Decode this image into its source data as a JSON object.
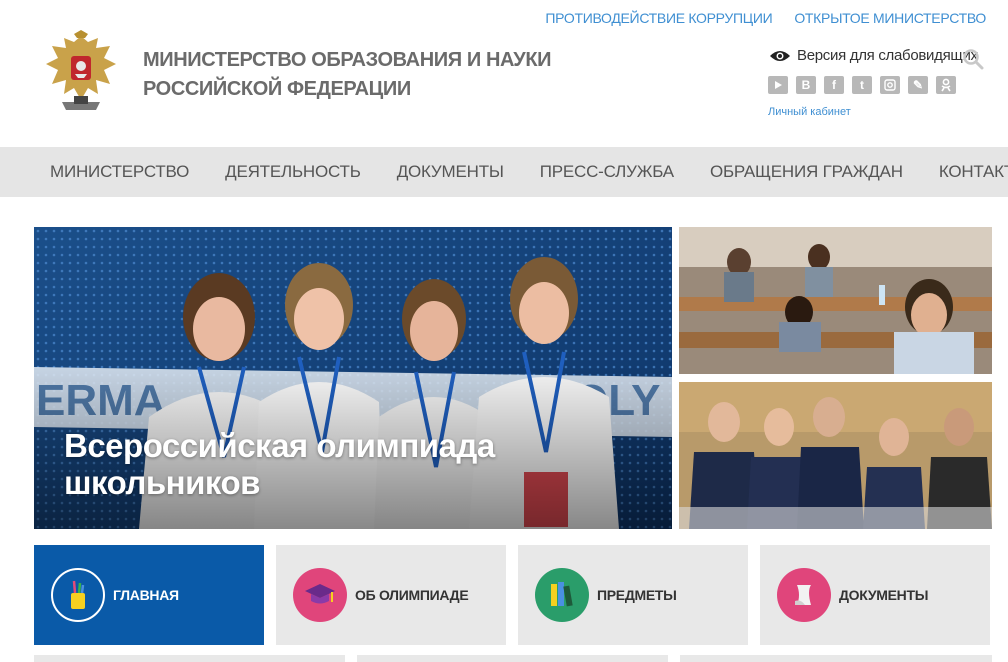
{
  "header": {
    "top_links": [
      "ПРОТИВОДЕЙСТВИЕ КОРРУПЦИИ",
      "ОТКРЫТОЕ МИНИСТЕРСТВО"
    ],
    "ministry_line1": "МИНИСТЕРСТВО ОБРАЗОВАНИЯ И НАУКИ",
    "ministry_line2": "РОССИЙСКОЙ ФЕДЕРАЦИИ",
    "accessibility_label": "Версия для слабовидящих",
    "socials": [
      "youtube-icon",
      "vk-icon",
      "facebook-icon",
      "twitter-icon",
      "instagram-icon",
      "livejournal-icon",
      "odnoklassniki-icon"
    ],
    "cabinet_label": "Личный кабинет"
  },
  "nav": {
    "items": [
      "МИНИСТЕРСТВО",
      "ДЕЯТЕЛЬНОСТЬ",
      "ДОКУМЕНТЫ",
      "ПРЕСС-СЛУЖБА",
      "ОБРАЩЕНИЯ ГРАЖДАН",
      "КОНТАКТЫ"
    ]
  },
  "hero": {
    "title_line1": "Всероссийская олимпиада",
    "title_line2": "школьников"
  },
  "tiles": [
    {
      "label": "ГЛАВНАЯ",
      "icon": "pencil-cup-icon",
      "color": "#0a5aa8"
    },
    {
      "label": "ОБ ОЛИМПИАДЕ",
      "icon": "graduation-cap-icon",
      "color": "#e0457b"
    },
    {
      "label": "ПРЕДМЕТЫ",
      "icon": "books-icon",
      "color": "#2a9d6a"
    },
    {
      "label": "ДОКУМЕНТЫ",
      "icon": "document-icon",
      "color": "#e0457b"
    }
  ],
  "colors": {
    "link": "#3f8fd2",
    "nav_bg": "#e5e5e5",
    "active_tile": "#0a5aa8",
    "tile_bg": "#e8e8e8"
  }
}
